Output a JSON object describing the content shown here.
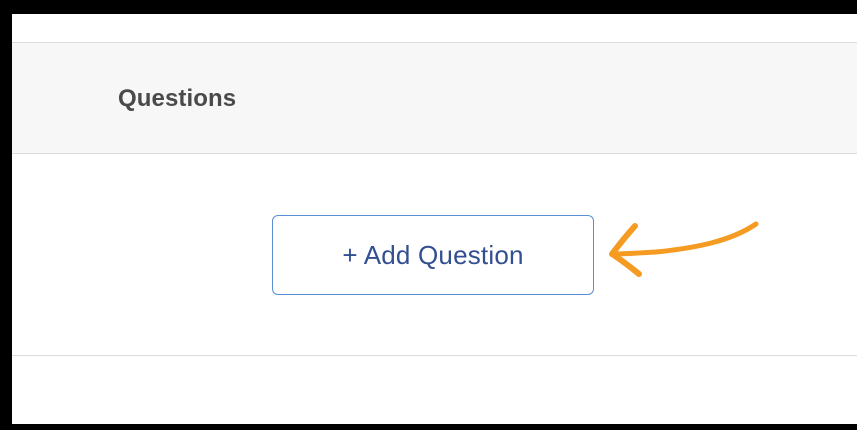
{
  "questions_panel": {
    "title": "Questions",
    "add_question_label": "+ Add Question"
  },
  "annotation": {
    "icon": "arrow-pointer-icon",
    "color": "#f59b21"
  },
  "colors": {
    "button_border": "#5a8fd4",
    "button_text": "#334f91",
    "header_background": "#f7f7f7",
    "frame": "#000000"
  }
}
